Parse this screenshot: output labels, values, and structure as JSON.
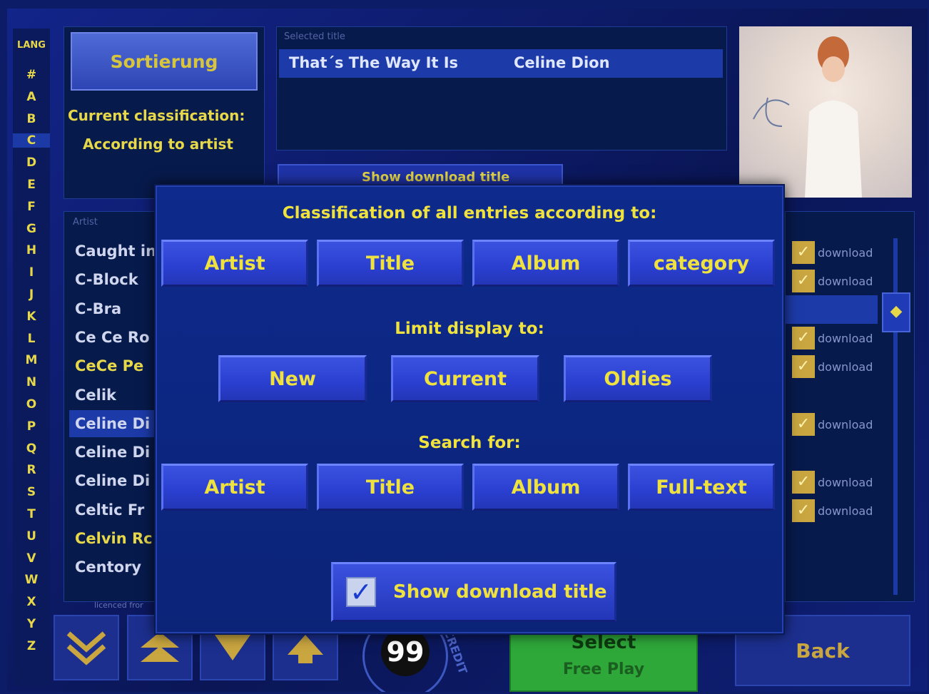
{
  "sidebar": {
    "lang_label": "LANG",
    "letters": [
      "#",
      "A",
      "B",
      "C",
      "D",
      "E",
      "F",
      "G",
      "H",
      "I",
      "J",
      "K",
      "L",
      "M",
      "N",
      "O",
      "P",
      "Q",
      "R",
      "S",
      "T",
      "U",
      "V",
      "W",
      "X",
      "Y",
      "Z"
    ],
    "selected_letter": "C"
  },
  "sort_panel": {
    "sort_button": "Sortierung",
    "current_label": "Current classification:",
    "current_value": "According to artist"
  },
  "selected": {
    "header": "Selected title",
    "title": "That´s The Way It Is",
    "artist": "Celine Dion"
  },
  "background_checkbox_label": "Show download title",
  "artist_list": {
    "header": "Artist",
    "items": [
      {
        "name": "Caught in",
        "style": "normal"
      },
      {
        "name": "C-Block",
        "style": "normal"
      },
      {
        "name": "C-Bra",
        "style": "normal"
      },
      {
        "name": "Ce Ce Ro",
        "style": "normal"
      },
      {
        "name": "CeCe Pe",
        "style": "highlight"
      },
      {
        "name": "Celik",
        "style": "normal"
      },
      {
        "name": "Celine Di",
        "style": "selected"
      },
      {
        "name": "Celine Di",
        "style": "normal"
      },
      {
        "name": "Celine Di",
        "style": "normal"
      },
      {
        "name": "Celtic Fr",
        "style": "normal"
      },
      {
        "name": "Celvin Rc",
        "style": "highlight"
      },
      {
        "name": "Centory",
        "style": "normal"
      }
    ],
    "footer": "licenced fror"
  },
  "download_list": {
    "label": "download",
    "check_icon": "check-icon"
  },
  "modal": {
    "classification_heading": "Classification of all entries according to:",
    "classification_buttons": [
      "Artist",
      "Title",
      "Album",
      "category"
    ],
    "limit_heading": "Limit display to:",
    "limit_buttons": [
      "New",
      "Current",
      "Oldies"
    ],
    "search_heading": "Search for:",
    "search_buttons": [
      "Artist",
      "Title",
      "Album",
      "Full-text"
    ],
    "show_download_label": "Show download title",
    "show_download_checked": true
  },
  "bottom_bar": {
    "credit_number": "99",
    "credit_word": "CREDIT",
    "select_label": "Select",
    "free_play_label": "Free Play",
    "back_label": "Back"
  },
  "colors": {
    "background": "#0d1c66",
    "accent_yellow": "#f0e23e",
    "button_blue": "#2a3fd0",
    "select_green": "#2fa83a"
  }
}
